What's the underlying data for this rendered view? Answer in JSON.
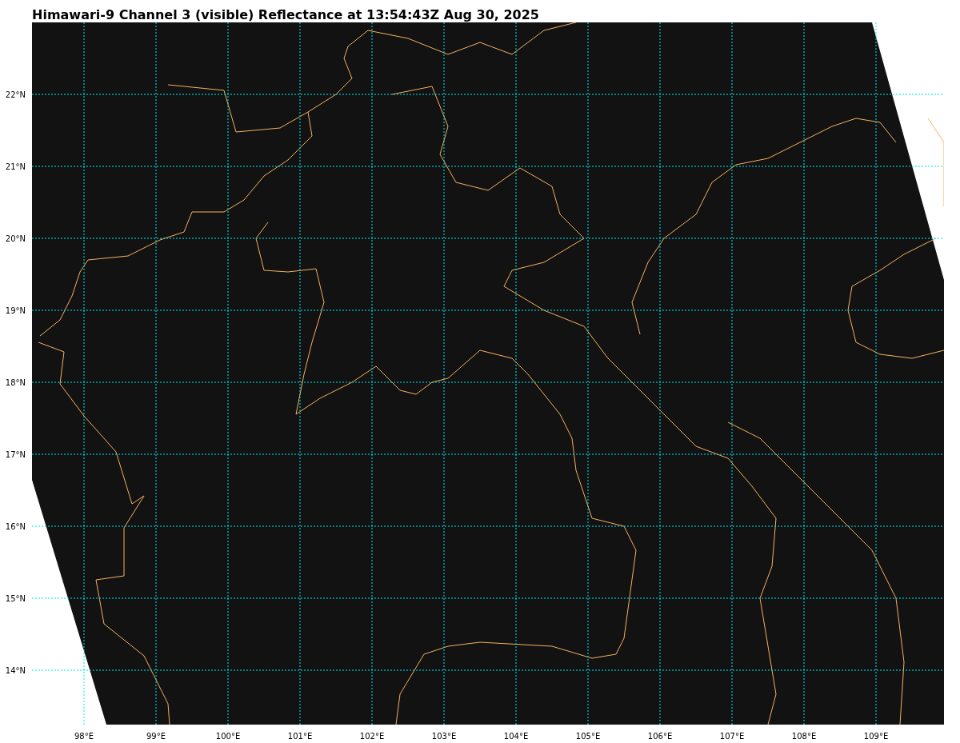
{
  "title": "Himawari-9 Channel 3 (visible) Reflectance at 13:54:43Z Aug 30, 2025",
  "map": {
    "lat_labels": [
      "22°N",
      "21°N",
      "20°N",
      "19°N",
      "18°N",
      "17°N",
      "16°N",
      "15°N",
      "14°N"
    ],
    "lon_labels": [
      "98°E",
      "99°E",
      "100°E",
      "101°E",
      "102°E",
      "103°E",
      "104°E",
      "105°E",
      "106°E",
      "107°E",
      "108°E",
      "109°E"
    ]
  }
}
